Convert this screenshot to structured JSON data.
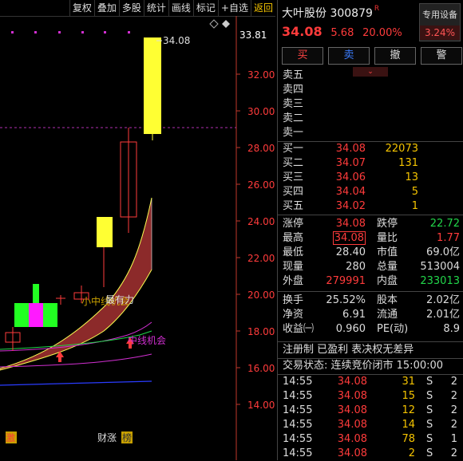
{
  "toolbar": {
    "items": [
      {
        "label": "复权"
      },
      {
        "label": "叠加"
      },
      {
        "label": "多股"
      },
      {
        "label": "统计"
      },
      {
        "label": "画线"
      },
      {
        "label": "标记"
      },
      {
        "label": "+自选"
      },
      {
        "label": "返回"
      }
    ]
  },
  "chart": {
    "price_axis": [
      "32.00",
      "30.00",
      "28.00",
      "26.00",
      "24.00",
      "22.00",
      "20.00",
      "18.00",
      "16.00",
      "14.00"
    ],
    "high_label": "34.08",
    "axis_top_value": "33.81",
    "annotations": {
      "a1": "小中线机会",
      "a2": "最有力",
      "a3": "中线机会"
    },
    "bottom_tags": {
      "t1": "激",
      "t2": "财涨",
      "t3": "榜"
    },
    "colors": {
      "up": "#ff3b3b",
      "down": "#19c3c3",
      "limit_up_candle": "#ffff33",
      "band": "#8c2a2a"
    }
  },
  "quote": {
    "name": "大叶股份",
    "code": "300879",
    "tag": "R",
    "device_label": "专用设备",
    "device_pct": "3.24%",
    "price": "34.08",
    "change": "5.68",
    "change_pct": "20.00%",
    "actions": {
      "buy": "买",
      "sell": "卖",
      "cancel": "撤",
      "alert": "警"
    },
    "asks": [
      {
        "label": "卖五"
      },
      {
        "label": "卖四"
      },
      {
        "label": "卖三"
      },
      {
        "label": "卖二"
      },
      {
        "label": "卖一"
      }
    ],
    "bids": [
      {
        "label": "买一",
        "price": "34.08",
        "vol": "22073"
      },
      {
        "label": "买二",
        "price": "34.07",
        "vol": "131"
      },
      {
        "label": "买三",
        "price": "34.06",
        "vol": "13"
      },
      {
        "label": "买四",
        "price": "34.04",
        "vol": "5"
      },
      {
        "label": "买五",
        "price": "34.02",
        "vol": "1"
      }
    ],
    "stats": {
      "limit_up_label": "涨停",
      "limit_up": "34.08",
      "limit_down_label": "跌停",
      "limit_down": "22.72",
      "high_label": "最高",
      "high": "34.08",
      "vol_ratio_label": "量比",
      "vol_ratio": "1.77",
      "low_label": "最低",
      "low": "28.40",
      "mktcap_label": "市值",
      "mktcap": "69.0亿",
      "cur_vol_label": "现量",
      "cur_vol": "280",
      "total_vol_label": "总量",
      "total_vol": "513004",
      "outer_label": "外盘",
      "outer": "279991",
      "inner_label": "内盘",
      "inner": "233013",
      "turnover_label": "换手",
      "turnover": "25.52%",
      "capital_label": "股本",
      "capital": "2.02亿",
      "nav_label": "净资",
      "nav": "6.91",
      "float_label": "流通",
      "float": "2.01亿",
      "eps_label": "收益㈠",
      "eps": "0.960",
      "pe_label": "PE(动)",
      "pe": "8.9"
    },
    "info_line": "注册制 已盈利 表决权无差异",
    "status_line": "交易状态: 连续竞价闭市 15:00:00",
    "ticks": [
      {
        "time": "14:55",
        "price": "34.08",
        "vol": "31",
        "side": "S",
        "n": "2"
      },
      {
        "time": "14:55",
        "price": "34.08",
        "vol": "15",
        "side": "S",
        "n": "2"
      },
      {
        "time": "14:55",
        "price": "34.08",
        "vol": "12",
        "side": "S",
        "n": "2"
      },
      {
        "time": "14:55",
        "price": "34.08",
        "vol": "14",
        "side": "S",
        "n": "2"
      },
      {
        "time": "14:55",
        "price": "34.08",
        "vol": "78",
        "side": "S",
        "n": "1"
      },
      {
        "time": "14:55",
        "price": "34.08",
        "vol": "2",
        "side": "S",
        "n": "2"
      }
    ]
  }
}
